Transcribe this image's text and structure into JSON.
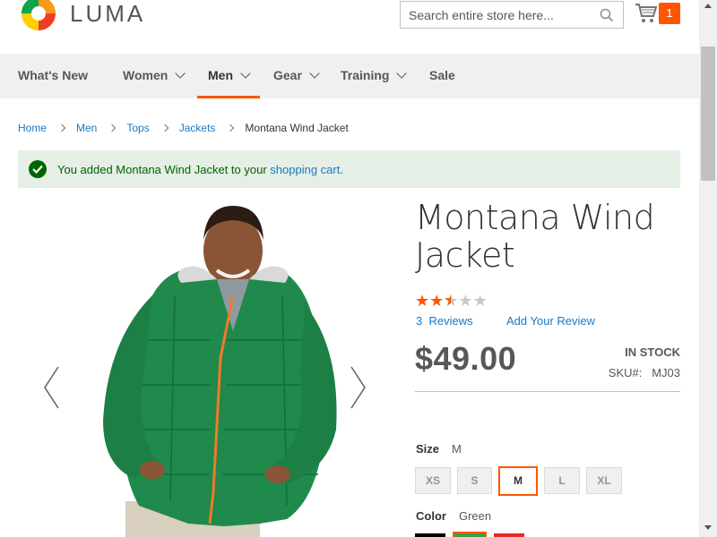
{
  "header": {
    "logo_text": "LUMA",
    "search_placeholder": "Search entire store here...",
    "cart_count": "1"
  },
  "nav": {
    "items": [
      {
        "label": "What's New",
        "dropdown": false
      },
      {
        "label": "Women",
        "dropdown": true
      },
      {
        "label": "Men",
        "dropdown": true,
        "active": true
      },
      {
        "label": "Gear",
        "dropdown": true
      },
      {
        "label": "Training",
        "dropdown": true
      },
      {
        "label": "Sale",
        "dropdown": false
      }
    ]
  },
  "breadcrumb": {
    "items": [
      "Home",
      "Men",
      "Tops",
      "Jackets"
    ],
    "current": "Montana Wind Jacket"
  },
  "message": {
    "prefix": "You added Montana Wind Jacket to your ",
    "link": "shopping cart",
    "suffix": "."
  },
  "product": {
    "title": "Montana Wind Jacket",
    "rating_stars": 2.5,
    "rating_max": 5,
    "reviews_count": "3",
    "reviews_label": "Reviews",
    "add_review": "Add Your Review",
    "price": "$49.00",
    "stock": "IN STOCK",
    "sku_label": "SKU#:",
    "sku": "MJ03"
  },
  "options": {
    "size_label": "Size",
    "size_selected": "M",
    "sizes": [
      "XS",
      "S",
      "M",
      "L",
      "XL"
    ],
    "color_label": "Color",
    "color_selected": "Green",
    "swatch_colors": [
      "#000000",
      "#3f9e3f",
      "#e02b27"
    ]
  },
  "colors": {
    "accent": "#ff5501",
    "link": "#1979c3",
    "success_bg": "#e5efe5",
    "success_text": "#006400"
  }
}
